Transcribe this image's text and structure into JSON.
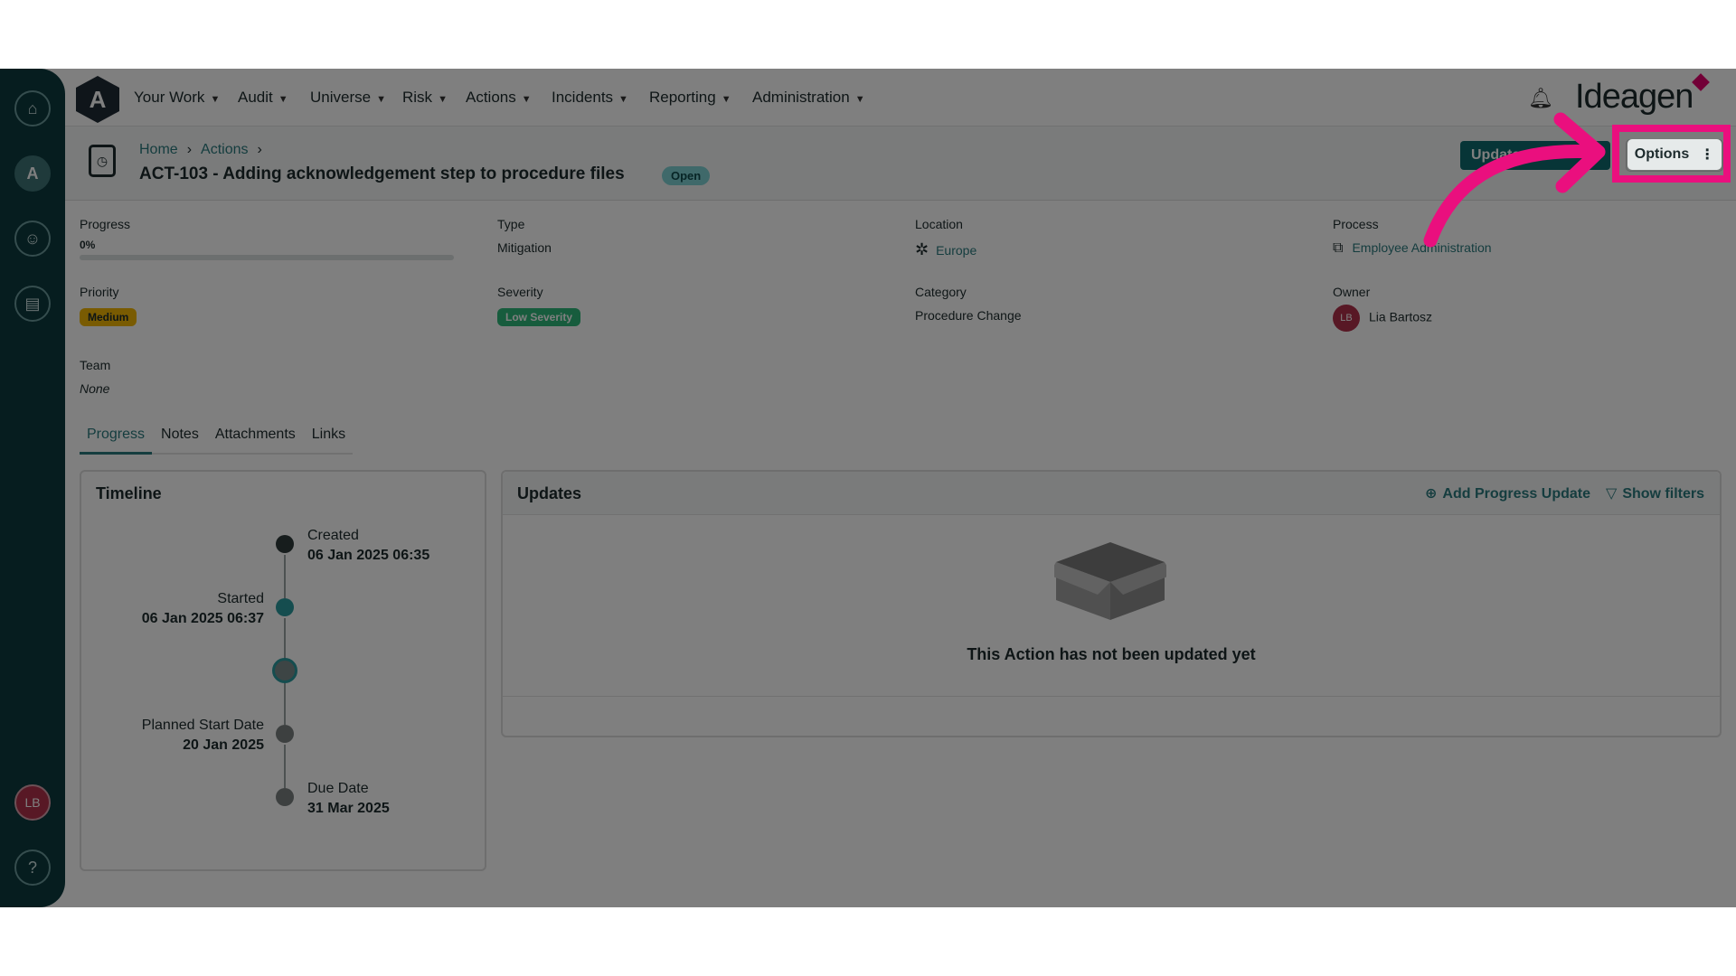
{
  "nav": {
    "items": [
      {
        "label": "Your Work"
      },
      {
        "label": "Audit"
      },
      {
        "label": "Universe"
      },
      {
        "label": "Risk"
      },
      {
        "label": "Actions"
      },
      {
        "label": "Incidents"
      },
      {
        "label": "Reporting"
      },
      {
        "label": "Administration"
      }
    ],
    "logo_letter": "A",
    "brand": "Ideagen"
  },
  "rail": {
    "avatar_initials": "LB",
    "help_label": "?"
  },
  "header": {
    "breadcrumb": [
      "Home",
      "Actions"
    ],
    "title": "ACT-103 - Adding acknowledgement step to procedure files",
    "status": "Open",
    "update_label": "Update",
    "options_label": "Options"
  },
  "details": {
    "progress": {
      "label": "Progress",
      "value": "0%",
      "fraction": 0
    },
    "type": {
      "label": "Type",
      "value": "Mitigation"
    },
    "location": {
      "label": "Location",
      "value": "Europe"
    },
    "process": {
      "label": "Process",
      "value": "Employee Administration"
    },
    "priority": {
      "label": "Priority",
      "value": "Medium"
    },
    "severity": {
      "label": "Severity",
      "value": "Low Severity"
    },
    "category": {
      "label": "Category",
      "value": "Procedure Change"
    },
    "owner": {
      "label": "Owner",
      "initials": "LB",
      "value": "Lia Bartosz"
    },
    "team": {
      "label": "Team",
      "value": "None"
    }
  },
  "tabs": [
    "Progress",
    "Notes",
    "Attachments",
    "Links"
  ],
  "timeline": {
    "title": "Timeline",
    "events": [
      {
        "label": "Created",
        "date": "06 Jan 2025 06:35"
      },
      {
        "label": "Started",
        "date": "06 Jan 2025 06:37"
      },
      {
        "label": "Planned Start Date",
        "date": "20 Jan 2025"
      },
      {
        "label": "Due Date",
        "date": "31 Mar 2025"
      }
    ]
  },
  "updates": {
    "title": "Updates",
    "add_label": "Add Progress Update",
    "filter_label": "Show filters",
    "empty_text": "This Action has not been updated yet"
  },
  "colors": {
    "rail": "#0d3b3e",
    "accent": "#2a7a7e",
    "highlight": "#ea0f7e",
    "medium": "#f2b705",
    "low_severity": "#2eb97a"
  }
}
